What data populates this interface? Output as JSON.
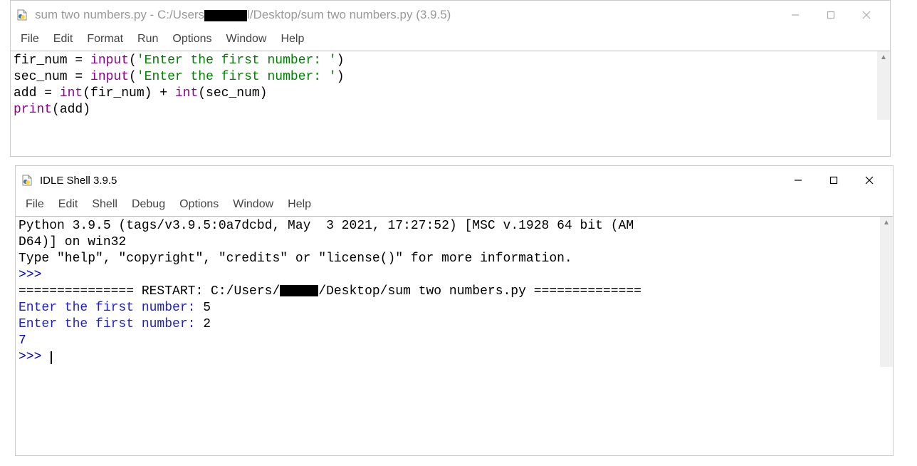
{
  "editor": {
    "title_prefix": "sum two numbers.py - C:/Users",
    "title_suffix": "l/Desktop/sum two numbers.py (3.9.5)",
    "menus": [
      "File",
      "Edit",
      "Format",
      "Run",
      "Options",
      "Window",
      "Help"
    ],
    "code": {
      "line1_var": "fir_num = ",
      "line1_func": "input",
      "line1_paren_open": "(",
      "line1_str": "'Enter the first number: '",
      "line1_paren_close": ")",
      "line2_var": "sec_num = ",
      "line2_func": "input",
      "line2_paren_open": "(",
      "line2_str": "'Enter the first number: '",
      "line2_paren_close": ")",
      "line3_add": "add = ",
      "line3_int1": "int",
      "line3_args1": "(fir_num) + ",
      "line3_int2": "int",
      "line3_args2": "(sec_num)",
      "line4_print": "print",
      "line4_args": "(add)"
    }
  },
  "shell": {
    "title": "IDLE Shell 3.9.5",
    "menus": [
      "File",
      "Edit",
      "Shell",
      "Debug",
      "Options",
      "Window",
      "Help"
    ],
    "banner_line1": "Python 3.9.5 (tags/v3.9.5:0a7dcbd, May  3 2021, 17:27:52) [MSC v.1928 64 bit (AM",
    "banner_line2": "D64)] on win32",
    "banner_line3": "Type \"help\", \"copyright\", \"credits\" or \"license()\" for more information.",
    "prompt": ">>>",
    "restart_pre": "=============== RESTART: C:/Users/",
    "restart_post": "/Desktop/sum two numbers.py ==============",
    "io_line1_prompt": "Enter the first number: ",
    "io_line1_input": "5",
    "io_line2_prompt": "Enter the first number: ",
    "io_line2_input": "2",
    "result": "7",
    "final_prompt": ">>> "
  }
}
